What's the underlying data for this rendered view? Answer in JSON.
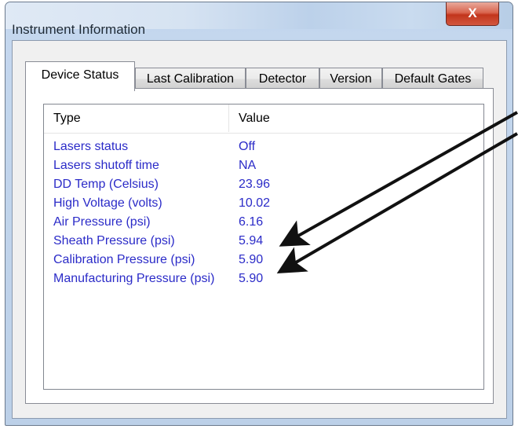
{
  "window": {
    "title": "Instrument Information",
    "close_label": "X"
  },
  "tabs": [
    {
      "label": "Device Status",
      "active": true
    },
    {
      "label": "Last Calibration",
      "active": false
    },
    {
      "label": "Detector",
      "active": false
    },
    {
      "label": "Version",
      "active": false
    },
    {
      "label": "Default Gates",
      "active": false
    }
  ],
  "list": {
    "columns": {
      "type": "Type",
      "value": "Value"
    },
    "rows": [
      {
        "type": "Lasers status",
        "value": "Off"
      },
      {
        "type": "Lasers shutoff time",
        "value": "NA"
      },
      {
        "type": "DD Temp (Celsius)",
        "value": "23.96"
      },
      {
        "type": "High Voltage (volts)",
        "value": "10.02"
      },
      {
        "type": "Air Pressure (psi)",
        "value": "6.16"
      },
      {
        "type": "Sheath Pressure (psi)",
        "value": "5.94"
      },
      {
        "type": "Calibration Pressure (psi)",
        "value": "5.90"
      },
      {
        "type": "Manufacturing Pressure (psi)",
        "value": "5.90"
      }
    ],
    "row_text_color": "#2b2bc8"
  },
  "annotation_arrows": {
    "color": "#111111",
    "count": 2
  }
}
